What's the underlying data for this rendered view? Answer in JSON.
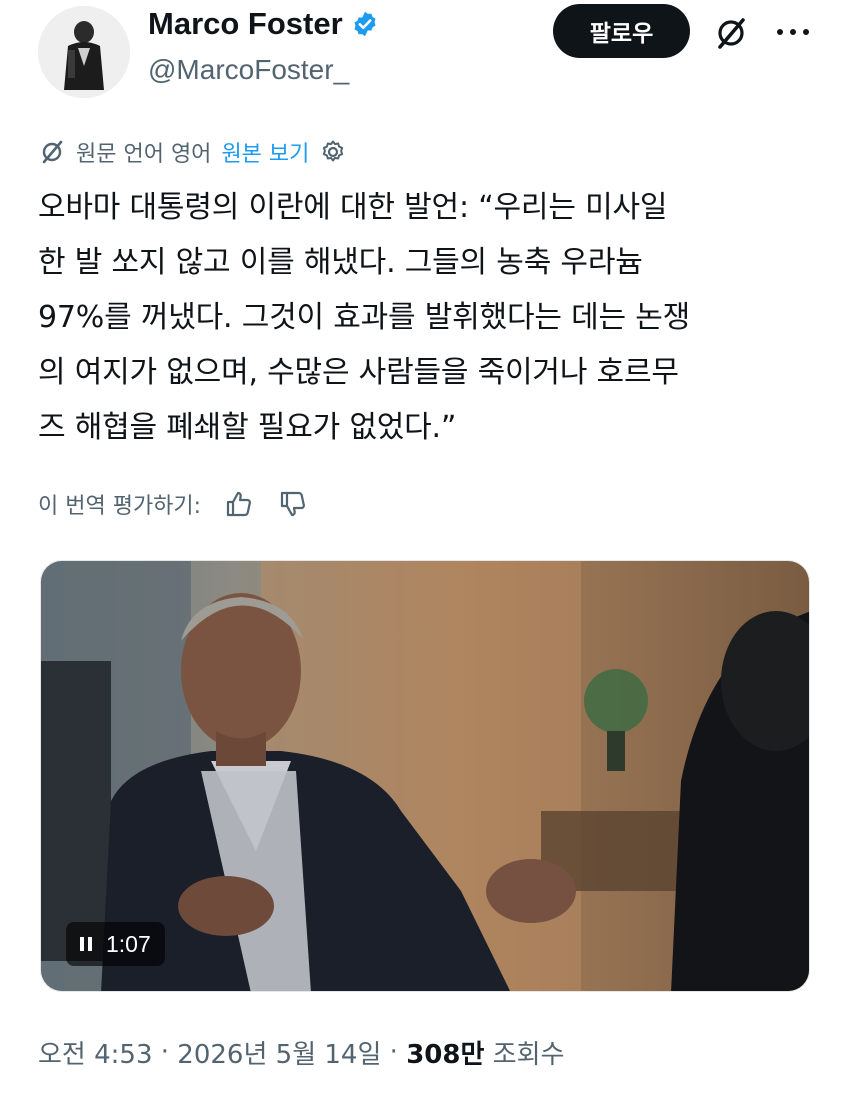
{
  "author": {
    "display_name": "Marco Foster",
    "handle": "@MarcoFoster_",
    "verified": true
  },
  "header": {
    "follow_label": "팔로우",
    "grok_icon": "grok-icon",
    "more_icon": "more-icon"
  },
  "translation": {
    "source_language_label": "원문 언어 영어",
    "view_original_label": "원본 보기",
    "rate_label": "이 번역 평가하기:"
  },
  "tweet": {
    "text": "오바마 대통령의 이란에 대한 발언: “우리는 미사일\n한 발 쏘지 않고 이를 해냈다. 그들의 농축 우라늄\n97%를 꺼냈다. 그것이 효과를 발휘했다는 데는 논쟁\n의 여지가 없으며, 수많은 사람들을 죽이거나 호르무\n즈 해협을 폐쇄할 필요가 없었다.”"
  },
  "video": {
    "elapsed": "1:07"
  },
  "meta": {
    "time": "오전 4:53",
    "separator": " · ",
    "date": "2026년 5월 14일",
    "views_number": "308만",
    "views_label": " 조회수"
  },
  "colors": {
    "accent": "#1d9bf0",
    "text_primary": "#0f1419",
    "text_secondary": "#536471",
    "follow_bg": "#0f1419"
  }
}
